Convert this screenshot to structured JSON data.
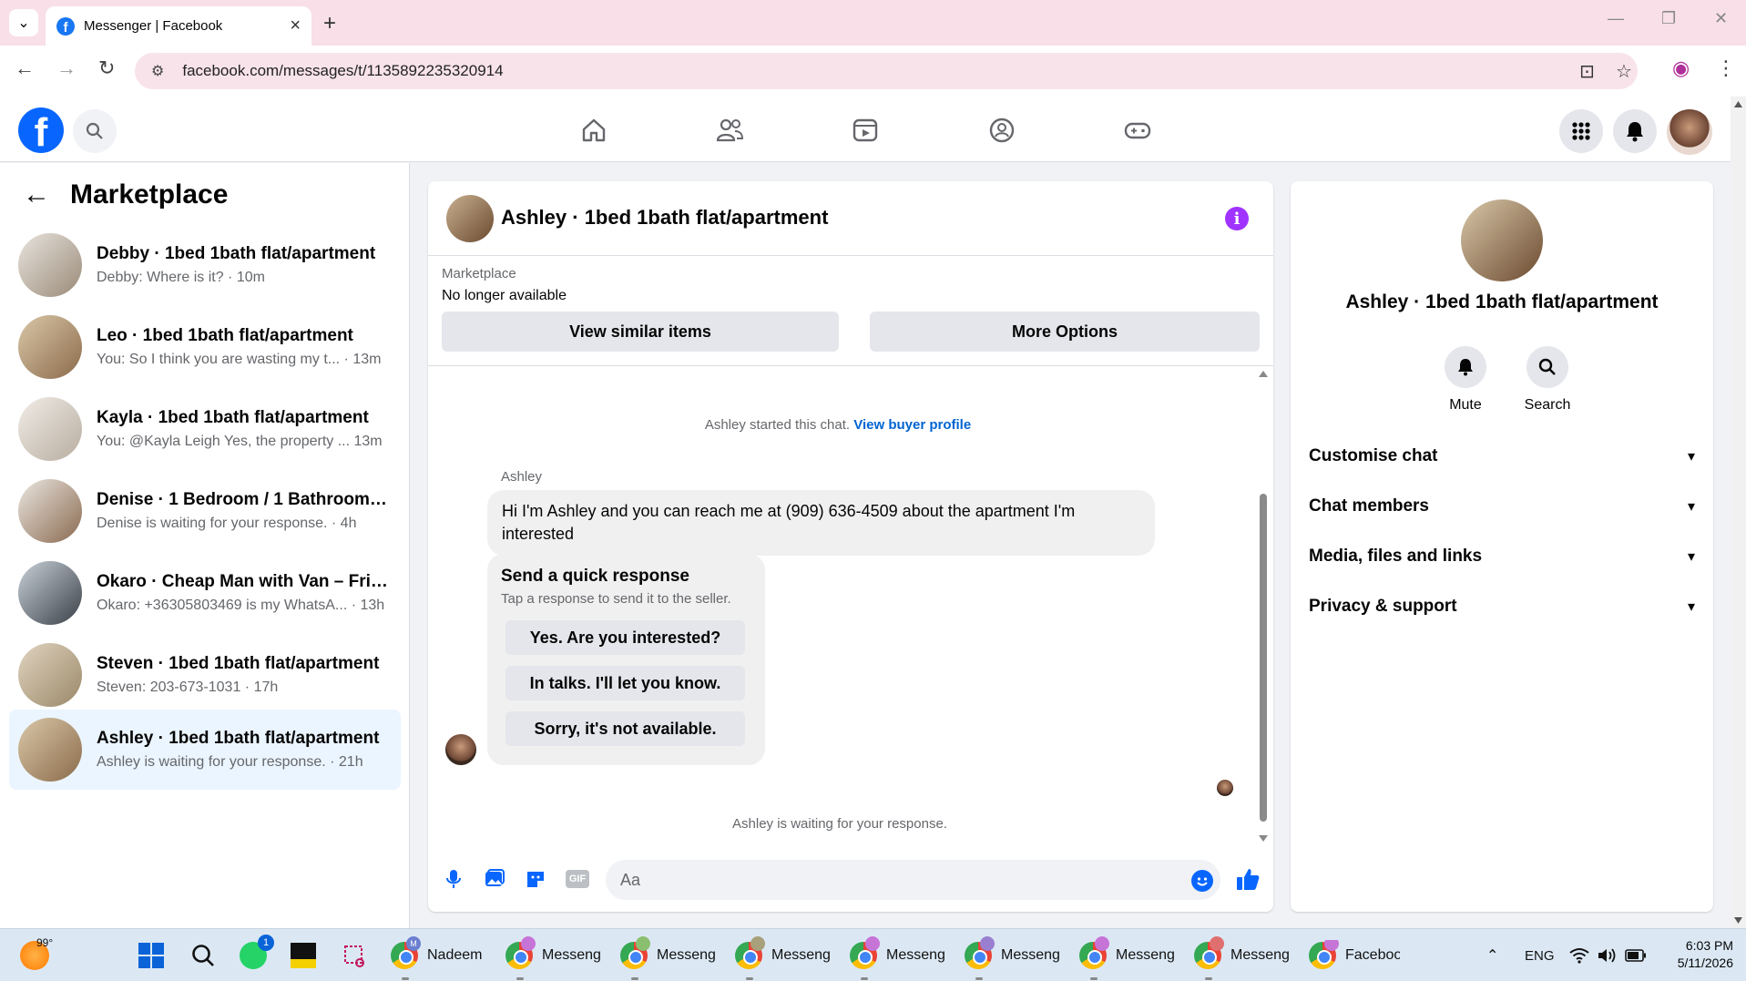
{
  "browser": {
    "tab_title": "Messenger | Facebook",
    "url": "facebook.com/messages/t/1135892235320914"
  },
  "sidebar": {
    "title": "Marketplace",
    "conversations": [
      {
        "name": "Debby · 1bed 1bath flat/apartment",
        "preview": "Debby: Where is it? · 10m"
      },
      {
        "name": "Leo · 1bed 1bath flat/apartment",
        "preview": "You: So I think you are wasting my t... · 13m"
      },
      {
        "name": "Kayla · 1bed 1bath flat/apartment",
        "preview": "You: @Kayla Leigh Yes, the property ... 13m"
      },
      {
        "name": "Denise · 1 Bedroom / 1 Bathroom ...",
        "preview": "Denise is waiting for your response. · 4h"
      },
      {
        "name": "Okaro · Cheap Man with Van – Frie...",
        "preview": "Okaro: +36305803469 is my WhatsA... · 13h"
      },
      {
        "name": "Steven · 1bed 1bath flat/apartment",
        "preview": "Steven: 203-673-1031 · 17h"
      },
      {
        "name": "Ashley · 1bed 1bath flat/apartment",
        "preview": "Ashley is waiting for your response. · 21h"
      }
    ]
  },
  "chat": {
    "title": "Ashley · 1bed 1bath flat/apartment",
    "listing_label": "Marketplace",
    "listing_status": "No longer available",
    "view_similar": "View similar items",
    "more_options": "More Options",
    "started_text": "Ashley started this chat.",
    "view_profile": "View buyer profile",
    "sender": "Ashley",
    "message": "Hi I'm Ashley and you can reach me at (909) 636-4509 about the apartment I'm interested",
    "quick_title": "Send a quick response",
    "quick_subtitle": "Tap a response to send it to the seller.",
    "quick_options": [
      "Yes. Are you interested?",
      "In talks. I'll let you know.",
      "Sorry, it's not available."
    ],
    "waiting": "Ashley is waiting for your response.",
    "input_placeholder": "Aa",
    "gif_label": "GIF"
  },
  "details": {
    "name": "Ashley · 1bed 1bath flat/apartment",
    "mute": "Mute",
    "search": "Search",
    "sections": [
      "Customise chat",
      "Chat members",
      "Media, files and links",
      "Privacy & support"
    ]
  },
  "taskbar": {
    "weather": "99°",
    "whatsapp_badge": "1",
    "apps": [
      "Nadeem",
      "Messeng",
      "Messeng",
      "Messeng",
      "Messeng",
      "Messeng",
      "Messeng",
      "Messeng",
      "Facebool"
    ],
    "nadeem_badge": "M",
    "lang": "ENG",
    "time": "6:03 PM",
    "date": "5/11/2026"
  },
  "colors": {
    "facebook_blue": "#0866ff",
    "info_purple": "#a033ff",
    "link_blue": "#0064d1",
    "active_row": "#ebf5ff"
  }
}
